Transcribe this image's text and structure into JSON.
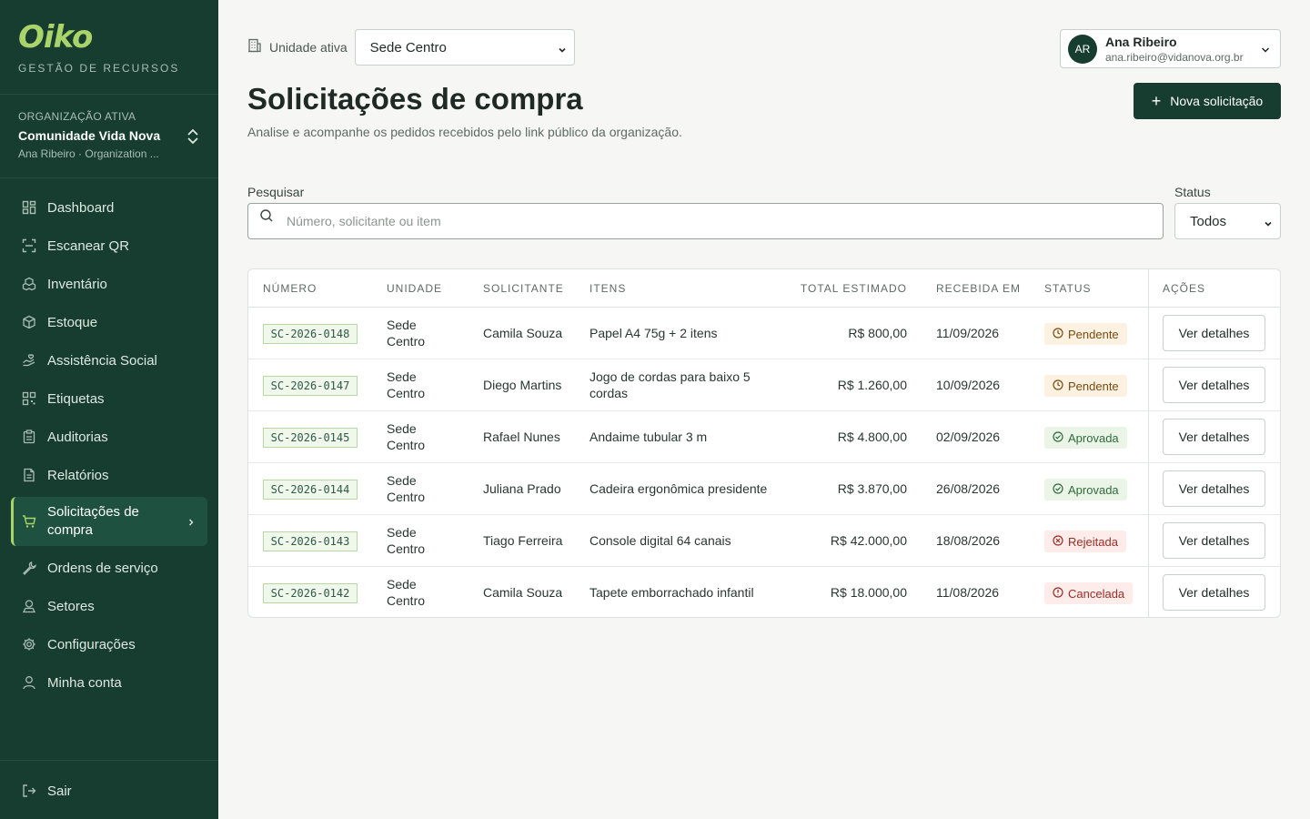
{
  "brand": {
    "logo": "Oiko",
    "tagline": "GESTÃO DE RECURSOS"
  },
  "org": {
    "label": "ORGANIZAÇÃO ATIVA",
    "name": "Comunidade Vida Nova",
    "sub": "Ana Ribeiro · Organization ..."
  },
  "nav": [
    {
      "label": "Dashboard",
      "icon": "dashboard-icon"
    },
    {
      "label": "Escanear QR",
      "icon": "scan-icon"
    },
    {
      "label": "Inventário",
      "icon": "inventory-icon"
    },
    {
      "label": "Estoque",
      "icon": "box-icon"
    },
    {
      "label": "Assistência Social",
      "icon": "hand-heart-icon"
    },
    {
      "label": "Etiquetas",
      "icon": "qr-icon"
    },
    {
      "label": "Auditorias",
      "icon": "clipboard-icon"
    },
    {
      "label": "Relatórios",
      "icon": "report-icon"
    },
    {
      "label": "Solicitações de compra",
      "icon": "cart-icon"
    },
    {
      "label": "Ordens de serviço",
      "icon": "wrench-icon"
    },
    {
      "label": "Setores",
      "icon": "sector-icon"
    },
    {
      "label": "Configurações",
      "icon": "gear-icon"
    },
    {
      "label": "Minha conta",
      "icon": "user-icon"
    }
  ],
  "logout": {
    "label": "Sair"
  },
  "unit": {
    "label": "Unidade ativa",
    "value": "Sede Centro"
  },
  "user": {
    "initials": "AR",
    "name": "Ana Ribeiro",
    "email": "ana.ribeiro@vidanova.org.br"
  },
  "page": {
    "title": "Solicitações de compra",
    "subtitle": "Analise e acompanhe os pedidos recebidos pelo link público da organização.",
    "new_button": "Nova solicitação"
  },
  "filters": {
    "search_label": "Pesquisar",
    "search_placeholder": "Número, solicitante ou item",
    "status_label": "Status",
    "status_value": "Todos"
  },
  "table": {
    "headers": [
      "NÚMERO",
      "UNIDADE",
      "SOLICITANTE",
      "ITENS",
      "TOTAL ESTIMADO",
      "RECEBIDA EM",
      "STATUS",
      "AÇÕES"
    ],
    "action_label": "Ver detalhes",
    "rows": [
      {
        "code": "SC-2026-0148",
        "unit": "Sede Centro",
        "requester": "Camila Souza",
        "items": "Papel A4 75g + 2 itens",
        "total": "R$ 800,00",
        "date": "11/09/2026",
        "status": "Pendente",
        "kind": "pend"
      },
      {
        "code": "SC-2026-0147",
        "unit": "Sede Centro",
        "requester": "Diego Martins",
        "items": "Jogo de cordas para baixo 5 cordas",
        "total": "R$ 1.260,00",
        "date": "10/09/2026",
        "status": "Pendente",
        "kind": "pend"
      },
      {
        "code": "SC-2026-0145",
        "unit": "Sede Centro",
        "requester": "Rafael Nunes",
        "items": "Andaime tubular 3 m",
        "total": "R$ 4.800,00",
        "date": "02/09/2026",
        "status": "Aprovada",
        "kind": "appr"
      },
      {
        "code": "SC-2026-0144",
        "unit": "Sede Centro",
        "requester": "Juliana Prado",
        "items": "Cadeira ergonômica presidente",
        "total": "R$ 3.870,00",
        "date": "26/08/2026",
        "status": "Aprovada",
        "kind": "appr"
      },
      {
        "code": "SC-2026-0143",
        "unit": "Sede Centro",
        "requester": "Tiago Ferreira",
        "items": "Console digital 64 canais",
        "total": "R$ 42.000,00",
        "date": "18/08/2026",
        "status": "Rejeitada",
        "kind": "rej"
      },
      {
        "code": "SC-2026-0142",
        "unit": "Sede Centro",
        "requester": "Camila Souza",
        "items": "Tapete emborrachado infantil",
        "total": "R$ 18.000,00",
        "date": "11/08/2026",
        "status": "Cancelada",
        "kind": "canc"
      }
    ]
  },
  "colors": {
    "sidebar": "#163d30",
    "accent": "#a9d46a",
    "primary": "#163d30"
  }
}
